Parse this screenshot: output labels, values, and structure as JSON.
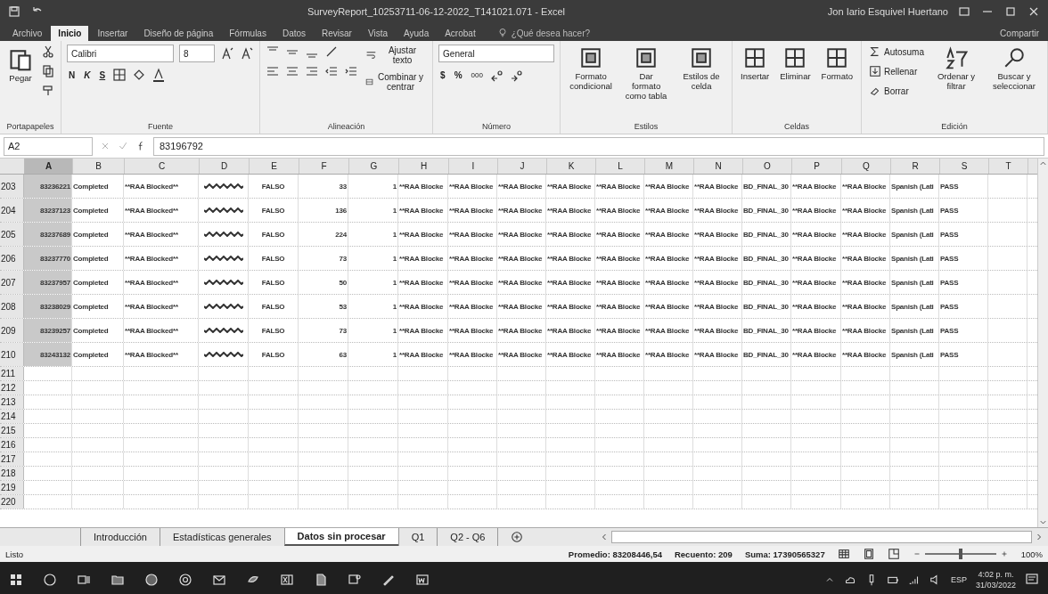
{
  "window": {
    "title": "SurveyReport_10253711-06-12-2022_T141021.071 - Excel",
    "user": "Jon Iario Esquivel Huertano"
  },
  "ribbon_tabs": [
    {
      "label": "Archivo",
      "selected": false
    },
    {
      "label": "Inicio",
      "selected": true
    },
    {
      "label": "Insertar",
      "selected": false
    },
    {
      "label": "Diseño de página",
      "selected": false
    },
    {
      "label": "Fórmulas",
      "selected": false
    },
    {
      "label": "Datos",
      "selected": false
    },
    {
      "label": "Revisar",
      "selected": false
    },
    {
      "label": "Vista",
      "selected": false
    },
    {
      "label": "Ayuda",
      "selected": false
    },
    {
      "label": "Acrobat",
      "selected": false
    }
  ],
  "tell_me": {
    "placeholder": "¿Qué desea hacer?"
  },
  "share": "Compartir",
  "ribbon": {
    "clipboard": {
      "paste": "Pegar",
      "label": "Portapapeles"
    },
    "font": {
      "family": "Calibri",
      "size": "8",
      "bold": "N",
      "italic": "K",
      "underline": "S",
      "label": "Fuente"
    },
    "alignment": {
      "wrap": "Ajustar texto",
      "merge": "Combinar y centrar",
      "label": "Alineación"
    },
    "number": {
      "format": "General",
      "currency": "$",
      "percent": "%",
      "thousands": "000",
      "label": "Número"
    },
    "styles": {
      "buttons": [
        "Formato condicional",
        "Dar formato como tabla",
        "Estilos de celda"
      ],
      "label": "Estilos"
    },
    "cells": {
      "buttons": [
        "Insertar",
        "Eliminar",
        "Formato"
      ],
      "label": "Celdas"
    },
    "editing": {
      "autosum": "Autosuma",
      "fill": "Rellenar",
      "clear": "Borrar",
      "sort": "Ordenar y filtrar",
      "find": "Buscar y seleccionar",
      "label": "Edición"
    }
  },
  "formula_bar": {
    "name_box": "A2",
    "value": "83196792"
  },
  "columns": [
    {
      "label": "A",
      "kind": "number",
      "selected": true
    },
    {
      "label": "B",
      "kind": "text",
      "selected": false
    },
    {
      "label": "C",
      "kind": "text",
      "selected": false
    },
    {
      "label": "D",
      "kind": "redacted",
      "selected": false
    },
    {
      "label": "E",
      "kind": "center",
      "selected": false
    },
    {
      "label": "F",
      "kind": "number",
      "selected": false
    },
    {
      "label": "G",
      "kind": "number",
      "selected": false
    },
    {
      "label": "H",
      "kind": "text",
      "selected": false
    },
    {
      "label": "I",
      "kind": "text",
      "selected": false
    },
    {
      "label": "J",
      "kind": "text",
      "selected": false
    },
    {
      "label": "K",
      "kind": "text",
      "selected": false
    },
    {
      "label": "L",
      "kind": "text",
      "selected": false
    },
    {
      "label": "M",
      "kind": "text",
      "selected": false
    },
    {
      "label": "N",
      "kind": "text",
      "selected": false
    },
    {
      "label": "O",
      "kind": "text",
      "selected": false
    },
    {
      "label": "P",
      "kind": "text",
      "selected": false
    },
    {
      "label": "Q",
      "kind": "text",
      "selected": false
    },
    {
      "label": "R",
      "kind": "text",
      "selected": false
    },
    {
      "label": "S",
      "kind": "text",
      "selected": false
    },
    {
      "label": "T",
      "kind": "text",
      "selected": false
    }
  ],
  "rows": [
    {
      "number": "203",
      "cells": [
        "83236221",
        "Completed",
        "**RAA Blocked**",
        "FALSO",
        "33",
        "1",
        "**RAA Blocke",
        "**RAA Blocke",
        "**RAA Blocke",
        "**RAA Blocke",
        "**RAA Blocke",
        "**RAA Blocke",
        "**RAA Blocke",
        "BD_FINAL_30",
        "**RAA Blocke",
        "**RAA Blocke",
        "Spanish (Lati",
        "PASS"
      ]
    },
    {
      "number": "204",
      "cells": [
        "83237123",
        "Completed",
        "**RAA Blocked**",
        "FALSO",
        "136",
        "1",
        "**RAA Blocke",
        "**RAA Blocke",
        "**RAA Blocke",
        "**RAA Blocke",
        "**RAA Blocke",
        "**RAA Blocke",
        "**RAA Blocke",
        "BD_FINAL_30",
        "**RAA Blocke",
        "**RAA Blocke",
        "Spanish (Lati",
        "PASS"
      ]
    },
    {
      "number": "205",
      "cells": [
        "83237689",
        "Completed",
        "**RAA Blocked**",
        "FALSO",
        "224",
        "1",
        "**RAA Blocke",
        "**RAA Blocke",
        "**RAA Blocke",
        "**RAA Blocke",
        "**RAA Blocke",
        "**RAA Blocke",
        "**RAA Blocke",
        "BD_FINAL_30",
        "**RAA Blocke",
        "**RAA Blocke",
        "Spanish (Lati",
        "PASS"
      ]
    },
    {
      "number": "206",
      "cells": [
        "83237770",
        "Completed",
        "**RAA Blocked**",
        "FALSO",
        "73",
        "1",
        "**RAA Blocke",
        "**RAA Blocke",
        "**RAA Blocke",
        "**RAA Blocke",
        "**RAA Blocke",
        "**RAA Blocke",
        "**RAA Blocke",
        "BD_FINAL_30",
        "**RAA Blocke",
        "**RAA Blocke",
        "Spanish (Lati",
        "PASS"
      ]
    },
    {
      "number": "207",
      "cells": [
        "83237957",
        "Completed",
        "**RAA Blocked**",
        "FALSO",
        "50",
        "1",
        "**RAA Blocke",
        "**RAA Blocke",
        "**RAA Blocke",
        "**RAA Blocke",
        "**RAA Blocke",
        "**RAA Blocke",
        "**RAA Blocke",
        "BD_FINAL_30",
        "**RAA Blocke",
        "**RAA Blocke",
        "Spanish (Lati",
        "PASS"
      ]
    },
    {
      "number": "208",
      "cells": [
        "83238029",
        "Completed",
        "**RAA Blocked**",
        "FALSO",
        "53",
        "1",
        "**RAA Blocke",
        "**RAA Blocke",
        "**RAA Blocke",
        "**RAA Blocke",
        "**RAA Blocke",
        "**RAA Blocke",
        "**RAA Blocke",
        "BD_FINAL_30",
        "**RAA Blocke",
        "**RAA Blocke",
        "Spanish (Lati",
        "PASS"
      ]
    },
    {
      "number": "209",
      "cells": [
        "83239257",
        "Completed",
        "**RAA Blocked**",
        "FALSO",
        "73",
        "1",
        "**RAA Blocke",
        "**RAA Blocke",
        "**RAA Blocke",
        "**RAA Blocke",
        "**RAA Blocke",
        "**RAA Blocke",
        "**RAA Blocke",
        "BD_FINAL_30",
        "**RAA Blocke",
        "**RAA Blocke",
        "Spanish (Lati",
        "PASS"
      ]
    },
    {
      "number": "210",
      "cells": [
        "83243132",
        "Completed",
        "**RAA Blocked**",
        "FALSO",
        "63",
        "1",
        "**RAA Blocke",
        "**RAA Blocke",
        "**RAA Blocke",
        "**RAA Blocke",
        "**RAA Blocke",
        "**RAA Blocke",
        "**RAA Blocke",
        "BD_FINAL_30",
        "**RAA Blocke",
        "**RAA Blocke",
        "Spanish (Lati",
        "PASS"
      ]
    },
    {
      "number": "211"
    },
    {
      "number": "212"
    },
    {
      "number": "213"
    },
    {
      "number": "214"
    },
    {
      "number": "215"
    },
    {
      "number": "216"
    },
    {
      "number": "217"
    },
    {
      "number": "218"
    },
    {
      "number": "219"
    },
    {
      "number": "220"
    }
  ],
  "sheet_tabs": [
    {
      "label": "Introducción",
      "selected": false
    },
    {
      "label": "Estadísticas generales",
      "selected": false
    },
    {
      "label": "Datos sin procesar",
      "selected": true
    },
    {
      "label": "Q1",
      "selected": false
    },
    {
      "label": "Q2 - Q6",
      "selected": false
    }
  ],
  "status_bar": {
    "mode": "Listo",
    "average": "Promedio: 83208446,54",
    "count": "Recuento: 209",
    "sum": "Suma: 17390565327",
    "zoom": {
      "level": 0.5
    },
    "zoom_label": "100%"
  },
  "taskbar": {
    "time": "4:02 p. m.",
    "date": "31/03/2022",
    "language": "ESP"
  }
}
